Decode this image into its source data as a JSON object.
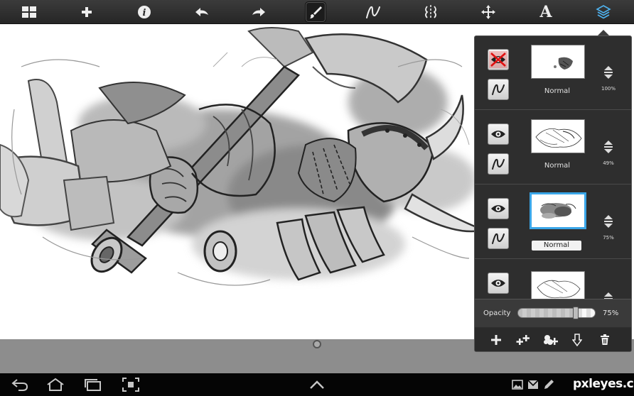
{
  "toolbar": {
    "items": [
      {
        "name": "gallery-icon"
      },
      {
        "name": "add-icon"
      },
      {
        "name": "info-icon"
      },
      {
        "name": "undo-icon"
      },
      {
        "name": "redo-icon"
      },
      {
        "name": "brush-icon",
        "active": true
      },
      {
        "name": "stroke-icon"
      },
      {
        "name": "symmetry-icon"
      },
      {
        "name": "transform-icon"
      },
      {
        "name": "text-icon",
        "glyph": "A"
      },
      {
        "name": "layers-icon",
        "highlight": "#4fb3f0"
      }
    ]
  },
  "layers": [
    {
      "visible": false,
      "thumb": "layer-1",
      "blend": "Normal",
      "opacity": "100%",
      "selected": false
    },
    {
      "visible": true,
      "thumb": "layer-2",
      "blend": "Normal",
      "opacity": "49%",
      "selected": false
    },
    {
      "visible": true,
      "thumb": "layer-3",
      "blend": "Normal",
      "opacity": "75%",
      "selected": true
    },
    {
      "visible": true,
      "thumb": "layer-4",
      "blend": "",
      "opacity": "",
      "selected": false
    }
  ],
  "opacity": {
    "label": "Opacity",
    "value": "75%",
    "fraction": 0.75
  },
  "panel_actions": [
    {
      "name": "add-layer-icon"
    },
    {
      "name": "duplicate-layer-icon"
    },
    {
      "name": "merge-layer-icon"
    },
    {
      "name": "move-layer-down-icon"
    },
    {
      "name": "delete-layer-icon"
    }
  ],
  "navbar": {
    "items": [
      {
        "name": "back-icon"
      },
      {
        "name": "home-icon"
      },
      {
        "name": "recent-apps-icon"
      },
      {
        "name": "screenshot-icon"
      },
      {
        "name": "expand-up-icon"
      }
    ],
    "status": [
      {
        "name": "gallery-notification-icon"
      },
      {
        "name": "mail-notification-icon"
      },
      {
        "name": "edit-notification-icon"
      }
    ]
  },
  "watermark": "pxleyes.com",
  "colors": {
    "accent": "#3aa6e8",
    "toolbar": "#2d2d2d",
    "panel": "#2e2e2e"
  }
}
